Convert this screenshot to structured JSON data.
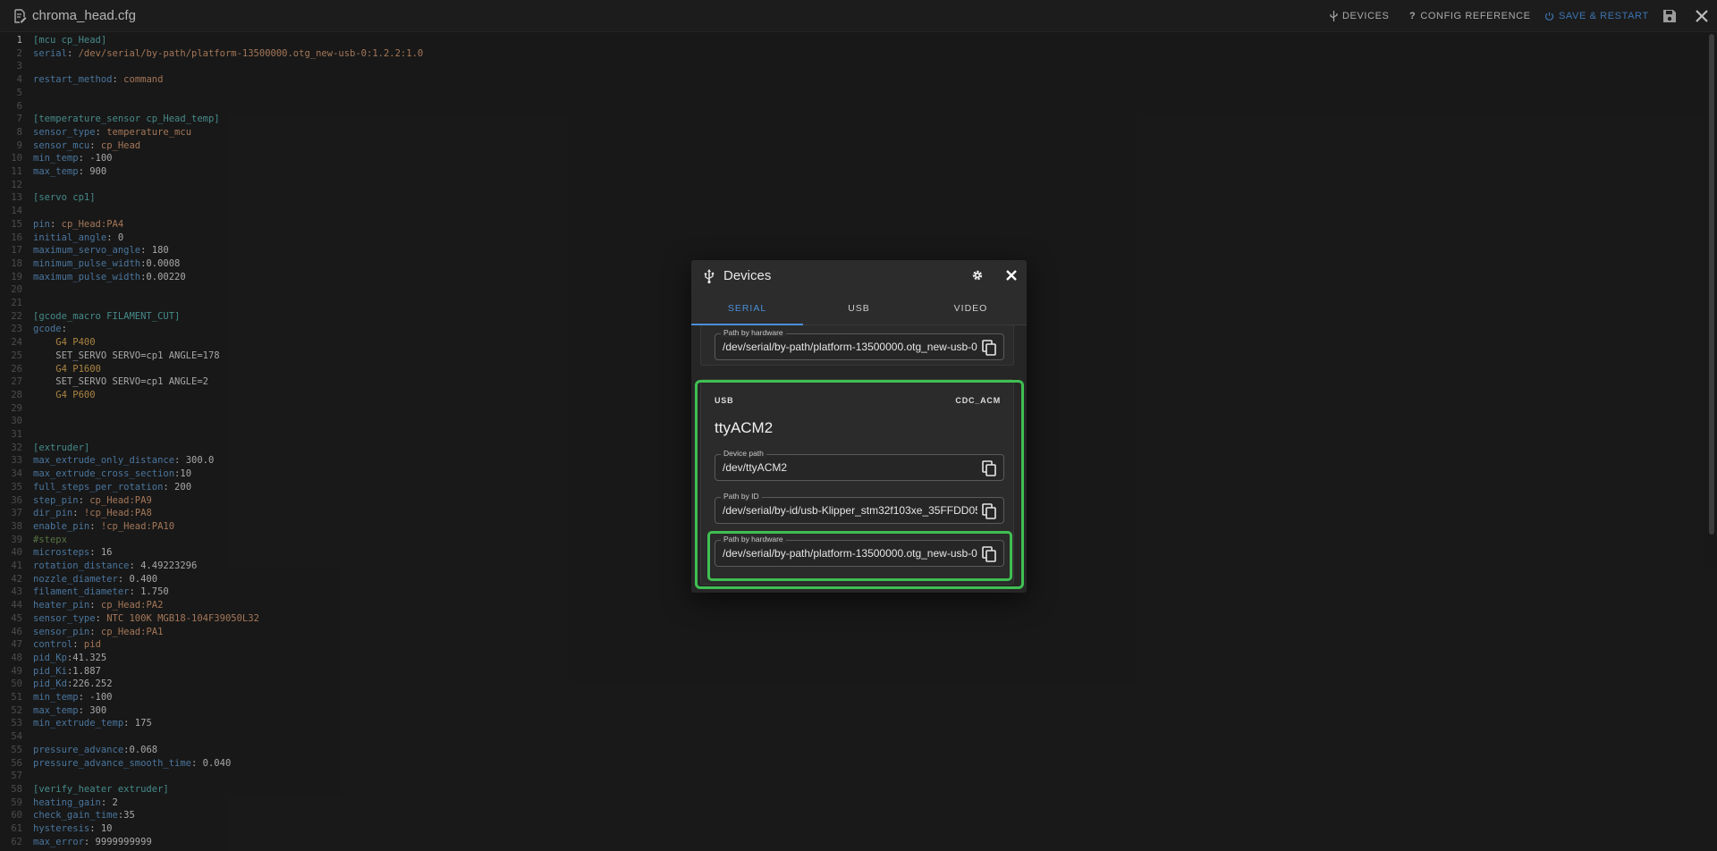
{
  "app": {
    "file_title": "chroma_head.cfg",
    "devices_label": "DEVICES",
    "config_reference_label": "CONFIG REFERENCE",
    "save_restart_label": "SAVE & RESTART"
  },
  "editor": {
    "lines": [
      {
        "n": "1",
        "parts": [
          [
            "sec",
            "[mcu cp_Head]"
          ]
        ]
      },
      {
        "n": "2",
        "parts": [
          [
            "key",
            "serial"
          ],
          [
            "plain",
            ": "
          ],
          [
            "val",
            "/dev/serial/by-path/platform-13500000.otg_new-usb-0:1.2.2:1.0"
          ]
        ]
      },
      {
        "n": "3",
        "parts": []
      },
      {
        "n": "4",
        "parts": [
          [
            "key",
            "restart_method"
          ],
          [
            "plain",
            ": "
          ],
          [
            "val",
            "command"
          ]
        ]
      },
      {
        "n": "5",
        "parts": []
      },
      {
        "n": "6",
        "parts": []
      },
      {
        "n": "7",
        "parts": [
          [
            "sec",
            "[temperature_sensor cp_Head_temp]"
          ]
        ]
      },
      {
        "n": "8",
        "parts": [
          [
            "key",
            "sensor_type"
          ],
          [
            "plain",
            ": "
          ],
          [
            "val",
            "temperature_mcu"
          ]
        ]
      },
      {
        "n": "9",
        "parts": [
          [
            "key",
            "sensor_mcu"
          ],
          [
            "plain",
            ": "
          ],
          [
            "val",
            "cp_Head"
          ]
        ]
      },
      {
        "n": "10",
        "parts": [
          [
            "key",
            "min_temp"
          ],
          [
            "plain",
            ": -100"
          ]
        ]
      },
      {
        "n": "11",
        "parts": [
          [
            "key",
            "max_temp"
          ],
          [
            "plain",
            ": 900"
          ]
        ]
      },
      {
        "n": "12",
        "parts": []
      },
      {
        "n": "13",
        "parts": [
          [
            "sec",
            "[servo cp1]"
          ]
        ]
      },
      {
        "n": "14",
        "parts": []
      },
      {
        "n": "15",
        "parts": [
          [
            "key",
            "pin"
          ],
          [
            "plain",
            ": "
          ],
          [
            "val",
            "cp_Head:PA4"
          ]
        ]
      },
      {
        "n": "16",
        "parts": [
          [
            "key",
            "initial_angle"
          ],
          [
            "plain",
            ": 0"
          ]
        ]
      },
      {
        "n": "17",
        "parts": [
          [
            "key",
            "maximum_servo_angle"
          ],
          [
            "plain",
            ": 180"
          ]
        ]
      },
      {
        "n": "18",
        "parts": [
          [
            "key",
            "minimum_pulse_width"
          ],
          [
            "plain",
            ":0.0008"
          ]
        ]
      },
      {
        "n": "19",
        "parts": [
          [
            "key",
            "maximum_pulse_width"
          ],
          [
            "plain",
            ":0.00220"
          ]
        ]
      },
      {
        "n": "20",
        "parts": []
      },
      {
        "n": "21",
        "parts": []
      },
      {
        "n": "22",
        "parts": [
          [
            "sec",
            "[gcode_macro FILAMENT_CUT]"
          ]
        ]
      },
      {
        "n": "23",
        "parts": [
          [
            "key",
            "gcode"
          ],
          [
            "plain",
            ":"
          ]
        ]
      },
      {
        "n": "24",
        "parts": [
          [
            "plain",
            "    "
          ],
          [
            "gcode",
            "G4 P400"
          ]
        ]
      },
      {
        "n": "25",
        "parts": [
          [
            "plain",
            "    SET_SERVO SERVO=cp1 ANGLE=178"
          ]
        ]
      },
      {
        "n": "26",
        "parts": [
          [
            "plain",
            "    "
          ],
          [
            "gcode",
            "G4 P1600"
          ]
        ]
      },
      {
        "n": "27",
        "parts": [
          [
            "plain",
            "    SET_SERVO SERVO=cp1 ANGLE=2"
          ]
        ]
      },
      {
        "n": "28",
        "parts": [
          [
            "plain",
            "    "
          ],
          [
            "gcode",
            "G4 P600"
          ]
        ]
      },
      {
        "n": "29",
        "parts": []
      },
      {
        "n": "30",
        "parts": []
      },
      {
        "n": "31",
        "parts": []
      },
      {
        "n": "32",
        "parts": [
          [
            "sec",
            "[extruder]"
          ]
        ]
      },
      {
        "n": "33",
        "parts": [
          [
            "key",
            "max_extrude_only_distance"
          ],
          [
            "plain",
            ": 300.0"
          ]
        ]
      },
      {
        "n": "34",
        "parts": [
          [
            "key",
            "max_extrude_cross_section"
          ],
          [
            "plain",
            ":10"
          ]
        ]
      },
      {
        "n": "35",
        "parts": [
          [
            "key",
            "full_steps_per_rotation"
          ],
          [
            "plain",
            ": 200"
          ]
        ]
      },
      {
        "n": "36",
        "parts": [
          [
            "key",
            "step_pin"
          ],
          [
            "plain",
            ": "
          ],
          [
            "val",
            "cp_Head:PA9"
          ]
        ]
      },
      {
        "n": "37",
        "parts": [
          [
            "key",
            "dir_pin"
          ],
          [
            "plain",
            ": "
          ],
          [
            "val",
            "!cp_Head:PA8"
          ]
        ]
      },
      {
        "n": "38",
        "parts": [
          [
            "key",
            "enable_pin"
          ],
          [
            "plain",
            ": "
          ],
          [
            "val",
            "!cp_Head:PA10"
          ]
        ]
      },
      {
        "n": "39",
        "parts": [
          [
            "cmt",
            "#stepx"
          ]
        ]
      },
      {
        "n": "40",
        "parts": [
          [
            "key",
            "microsteps"
          ],
          [
            "plain",
            ": 16"
          ]
        ]
      },
      {
        "n": "41",
        "parts": [
          [
            "key",
            "rotation_distance"
          ],
          [
            "plain",
            ": 4.49223296"
          ]
        ]
      },
      {
        "n": "42",
        "parts": [
          [
            "key",
            "nozzle_diameter"
          ],
          [
            "plain",
            ": 0.400"
          ]
        ]
      },
      {
        "n": "43",
        "parts": [
          [
            "key",
            "filament_diameter"
          ],
          [
            "plain",
            ": 1.750"
          ]
        ]
      },
      {
        "n": "44",
        "parts": [
          [
            "key",
            "heater_pin"
          ],
          [
            "plain",
            ": "
          ],
          [
            "val",
            "cp_Head:PA2"
          ]
        ]
      },
      {
        "n": "45",
        "parts": [
          [
            "key",
            "sensor_type"
          ],
          [
            "plain",
            ": "
          ],
          [
            "val",
            "NTC 100K MGB18-104F39050L32"
          ]
        ]
      },
      {
        "n": "46",
        "parts": [
          [
            "key",
            "sensor_pin"
          ],
          [
            "plain",
            ": "
          ],
          [
            "val",
            "cp_Head:PA1"
          ]
        ]
      },
      {
        "n": "47",
        "parts": [
          [
            "key",
            "control"
          ],
          [
            "plain",
            ": "
          ],
          [
            "val",
            "pid"
          ]
        ]
      },
      {
        "n": "48",
        "parts": [
          [
            "key",
            "pid_Kp"
          ],
          [
            "plain",
            ":41.325"
          ]
        ]
      },
      {
        "n": "49",
        "parts": [
          [
            "key",
            "pid_Ki"
          ],
          [
            "plain",
            ":1.887"
          ]
        ]
      },
      {
        "n": "50",
        "parts": [
          [
            "key",
            "pid_Kd"
          ],
          [
            "plain",
            ":226.252"
          ]
        ]
      },
      {
        "n": "51",
        "parts": [
          [
            "key",
            "min_temp"
          ],
          [
            "plain",
            ": -100"
          ]
        ]
      },
      {
        "n": "52",
        "parts": [
          [
            "key",
            "max_temp"
          ],
          [
            "plain",
            ": 300"
          ]
        ]
      },
      {
        "n": "53",
        "parts": [
          [
            "key",
            "min_extrude_temp"
          ],
          [
            "plain",
            ": 175"
          ]
        ]
      },
      {
        "n": "54",
        "parts": []
      },
      {
        "n": "55",
        "parts": [
          [
            "key",
            "pressure_advance"
          ],
          [
            "plain",
            ":0.068"
          ]
        ]
      },
      {
        "n": "56",
        "parts": [
          [
            "key",
            "pressure_advance_smooth_time"
          ],
          [
            "plain",
            ": 0.040"
          ]
        ]
      },
      {
        "n": "57",
        "parts": []
      },
      {
        "n": "58",
        "parts": [
          [
            "sec",
            "[verify_heater extruder]"
          ]
        ]
      },
      {
        "n": "59",
        "parts": [
          [
            "key",
            "heating_gain"
          ],
          [
            "plain",
            ": 2"
          ]
        ]
      },
      {
        "n": "60",
        "parts": [
          [
            "key",
            "check_gain_time"
          ],
          [
            "plain",
            ":35"
          ]
        ]
      },
      {
        "n": "61",
        "parts": [
          [
            "key",
            "hysteresis"
          ],
          [
            "plain",
            ": 10"
          ]
        ]
      },
      {
        "n": "62",
        "parts": [
          [
            "key",
            "max_error"
          ],
          [
            "plain",
            ": 9999999999"
          ]
        ]
      }
    ]
  },
  "dialog": {
    "title": "Devices",
    "tabs": [
      {
        "label": "SERIAL",
        "active": true
      },
      {
        "label": "USB",
        "active": false
      },
      {
        "label": "VIDEO",
        "active": false
      }
    ],
    "partial_card": {
      "path_by_hardware_label": "Path by hardware",
      "path_by_hardware_value": "/dev/serial/by-path/platform-13500000.otg_new-usb-0"
    },
    "device_card": {
      "type": "USB",
      "driver": "CDC_ACM",
      "name": "ttyACM2",
      "device_path_label": "Device path",
      "device_path_value": "/dev/ttyACM2",
      "path_by_id_label": "Path by ID",
      "path_by_id_value": "/dev/serial/by-id/usb-Klipper_stm32f103xe_35FFDD05",
      "path_by_hardware_label": "Path by hardware",
      "path_by_hardware_value": "/dev/serial/by-path/platform-13500000.otg_new-usb-0"
    }
  },
  "colors": {
    "accent": "#4a8fd8",
    "highlight": "#3fbf52",
    "background": "#1e1e1e"
  }
}
